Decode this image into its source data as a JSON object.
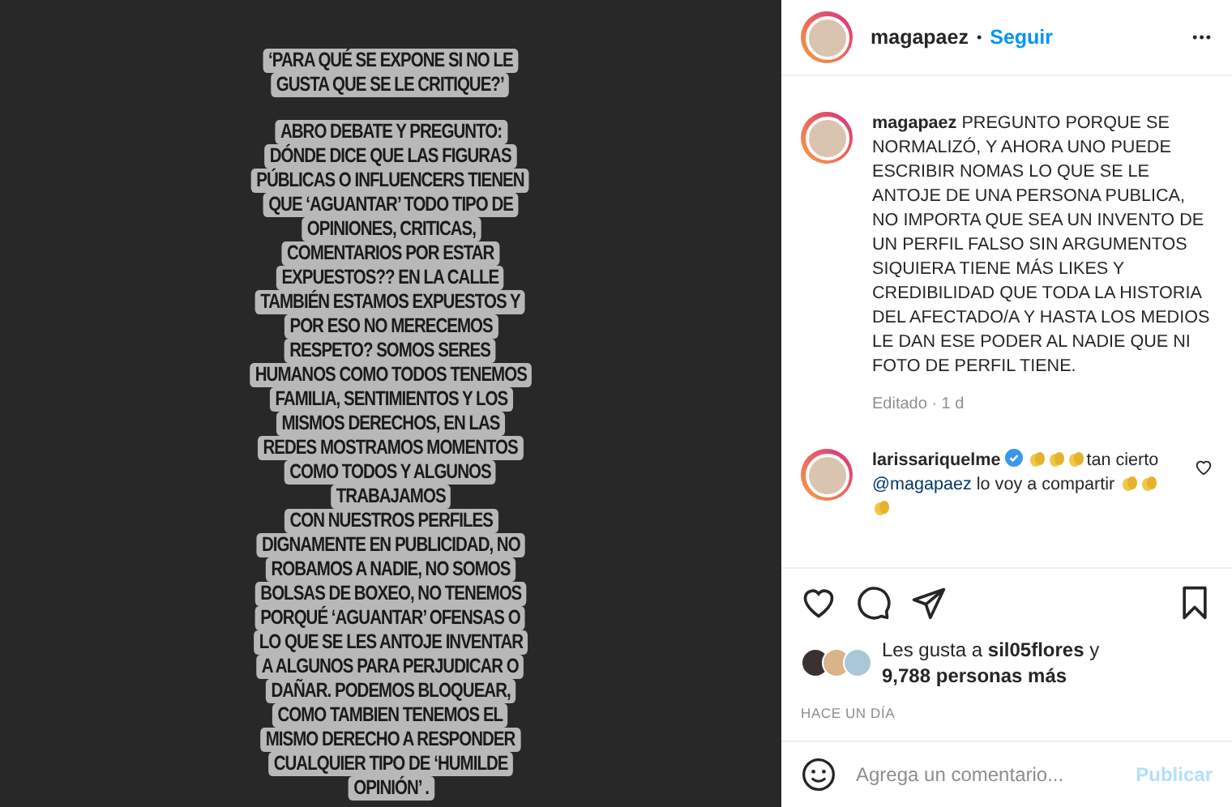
{
  "story": {
    "blocks": [
      [
        "‘PARA QUÉ SE EXPONE SI NO LE",
        "GUSTA QUE SE LE CRITIQUE?’"
      ],
      [
        "ABRO DEBATE Y PREGUNTO:",
        "DÓNDE DICE QUE LAS FIGURAS",
        "PÚBLICAS O INFLUENCERS TIENEN",
        "QUE ‘AGUANTAR’ TODO TIPO DE",
        "OPINIONES, CRITICAS,",
        "COMENTARIOS POR ESTAR",
        "EXPUESTOS?? EN LA CALLE",
        "TAMBIÉN ESTAMOS EXPUESTOS Y",
        "POR ESO NO MERECEMOS",
        "RESPETO? SOMOS SERES",
        "HUMANOS COMO TODOS TENEMOS",
        "FAMILIA, SENTIMIENTOS Y LOS",
        "MISMOS DERECHOS, EN LAS",
        "REDES MOSTRAMOS MOMENTOS",
        "COMO TODOS Y ALGUNOS",
        "TRABAJAMOS",
        "CON NUESTROS PERFILES",
        "DIGNAMENTE EN PUBLICIDAD, NO",
        "ROBAMOS A NADIE, NO SOMOS",
        "BOLSAS DE BOXEO, NO TENEMOS",
        "PORQUÉ ‘AGUANTAR’ OFENSAS O",
        "LO QUE SE LES ANTOJE INVENTAR",
        "A ALGUNOS PARA PERJUDICAR O",
        "DAÑAR. PODEMOS BLOQUEAR,",
        "COMO TAMBIEN TENEMOS EL",
        "MISMO DERECHO A RESPONDER",
        "CUALQUIER TIPO DE ‘HUMILDE",
        "OPINIÓN’ ."
      ]
    ]
  },
  "header": {
    "username": "magapaez",
    "separator": "•",
    "follow": "Seguir",
    "more": "•••"
  },
  "caption": {
    "username": "magapaez",
    "text": "PREGUNTO PORQUE SE NORMALIZÓ, Y AHORA UNO PUEDE ESCRIBIR NOMAS LO QUE SE LE ANTOJE DE UNA PERSONA PUBLICA, NO IMPORTA QUE SEA UN INVENTO DE UN PERFIL FALSO SIN ARGUMENTOS SIQUIERA TIENE MÁS LIKES Y CREDIBILIDAD QUE TODA LA HISTORIA DEL AFECTADO/A Y HASTA LOS MEDIOS LE DAN ESE PODER AL NADIE QUE NI FOTO DE PERFIL TIENE.",
    "meta": "Editado · 1 d"
  },
  "comments": [
    {
      "username": "larissariquelme",
      "verified": true,
      "liked": false,
      "parts": [
        {
          "kind": "clap"
        },
        {
          "kind": "clap"
        },
        {
          "kind": "clap"
        },
        {
          "kind": "text",
          "text": "tan cierto "
        },
        {
          "kind": "mention",
          "text": "@magapaez"
        },
        {
          "kind": "text",
          "text": " lo voy a compartir "
        },
        {
          "kind": "clap"
        },
        {
          "kind": "clap"
        },
        {
          "kind": "clap"
        }
      ]
    }
  ],
  "actions": {
    "liked": false,
    "saved": false
  },
  "likes": {
    "prefix": "Les gusta a ",
    "user": "sil05flores",
    "middle": " y",
    "count": "9,788 personas más"
  },
  "date": "HACE UN DÍA",
  "composer": {
    "placeholder": "Agrega un comentario...",
    "submit": "Publicar"
  }
}
